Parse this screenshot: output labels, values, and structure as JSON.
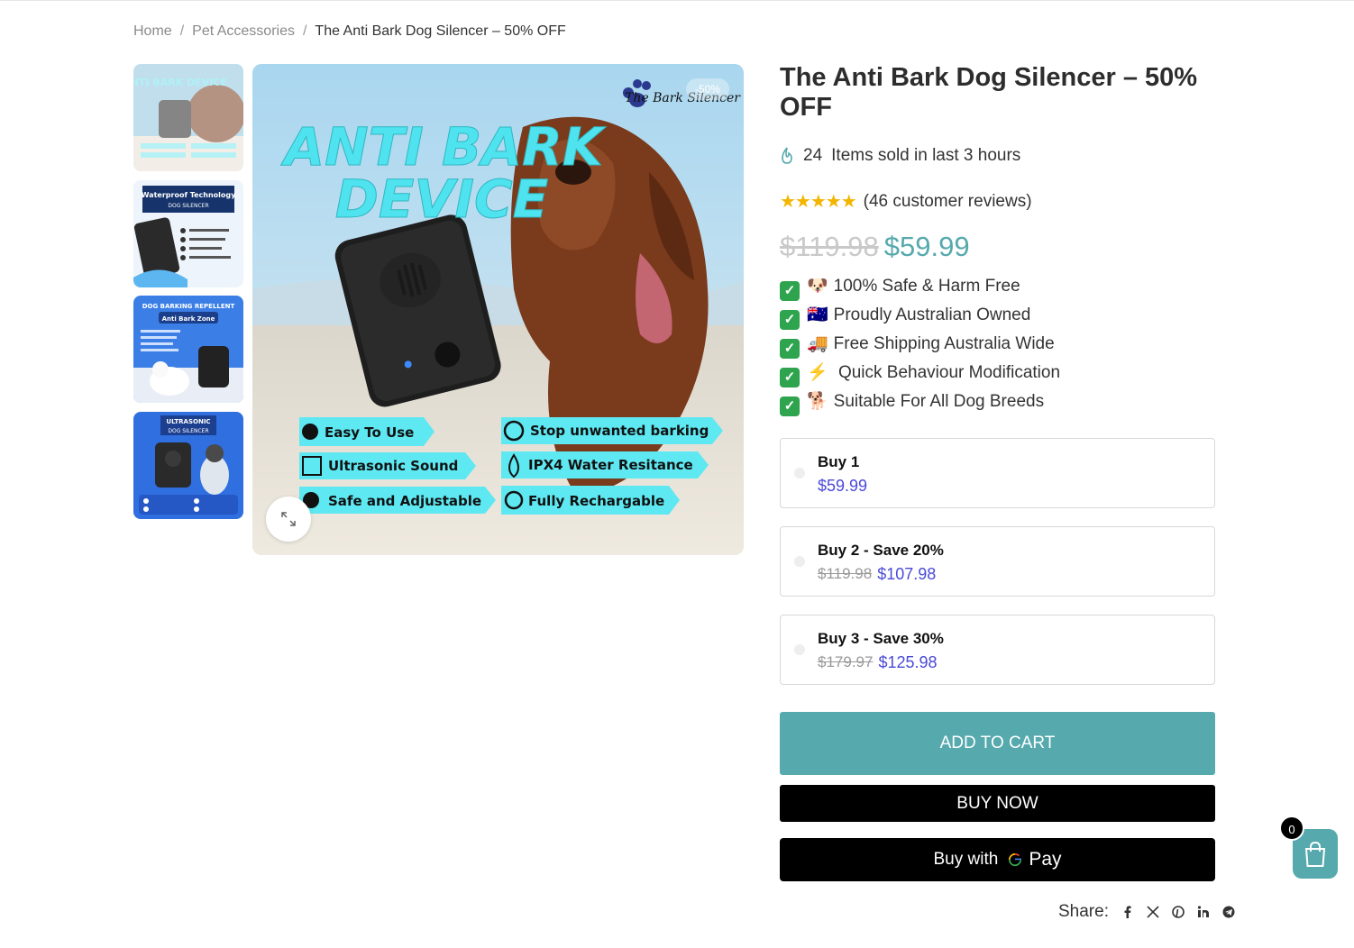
{
  "breadcrumb": {
    "items": [
      "Home",
      "Pet Accessories"
    ],
    "separator": "/",
    "current": "The Anti Bark Dog Silencer – 50% OFF"
  },
  "gallery": {
    "sale_badge": "-50%",
    "main_image": {
      "logo_text": "The Bark Silencer",
      "headline_line1": "ANTI BARK",
      "headline_line2": "DEVICE",
      "feature_labels": [
        "Easy To Use",
        "Stop unwanted barking",
        "Ultrasonic Sound",
        "IPX4 Water Resitance",
        "Safe and Adjustable",
        "Fully Rechargable"
      ]
    },
    "thumbnails": [
      {
        "title": "ANTI BARK DEVICE"
      },
      {
        "title": "Waterproof Technology",
        "subtitle": "DOG SILENCER"
      },
      {
        "title": "DOG BARKING REPELLENT",
        "subtitle": "Anti Bark Zone"
      },
      {
        "title": "ULTRASONIC",
        "subtitle": "DOG SILENCER"
      }
    ]
  },
  "product": {
    "title": "The Anti Bark Dog Silencer – 50% OFF",
    "sold_count": "24",
    "sold_text": "Items sold in last 3 hours",
    "rating_stars": "★★★★★",
    "reviews_text": "(46 customer reviews)",
    "old_price": "$119.98",
    "new_price": "$59.99",
    "features": [
      {
        "emoji": "🐶",
        "text": "100% Safe & Harm Free"
      },
      {
        "emoji": "🇦🇺",
        "text": "Proudly Australian Owned"
      },
      {
        "emoji": "🚚",
        "text": "Free Shipping Australia Wide"
      },
      {
        "emoji": "⚡",
        "text": " Quick Behaviour Modification"
      },
      {
        "emoji": "🐕",
        "text": "Suitable For All Dog Breeds"
      }
    ]
  },
  "options": [
    {
      "title": "Buy 1",
      "old_price": "",
      "price": "$59.99"
    },
    {
      "title": "Buy 2 - Save 20%",
      "old_price": "$119.98",
      "price": "$107.98"
    },
    {
      "title": "Buy 3 - Save 30%",
      "old_price": "$179.97",
      "price": "$125.98"
    }
  ],
  "buttons": {
    "add_to_cart": "ADD TO CART",
    "buy_now": "BUY NOW",
    "buy_with": "Buy with",
    "gpay_g": "G",
    "gpay_pay": "Pay"
  },
  "share": {
    "label": "Share:",
    "icons": [
      "facebook-icon",
      "x-icon",
      "pinterest-icon",
      "linkedin-icon",
      "telegram-icon"
    ]
  },
  "cart": {
    "count": "0"
  },
  "colors": {
    "accent": "#56a9ad",
    "option_price": "#4a4ad9",
    "star": "#f3b500"
  }
}
